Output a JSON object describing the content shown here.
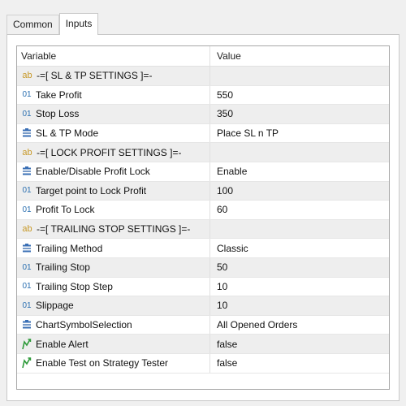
{
  "tabs": [
    {
      "label": "Common",
      "active": false
    },
    {
      "label": "Inputs",
      "active": true
    }
  ],
  "table": {
    "columns": [
      "Variable",
      "Value"
    ],
    "rows": [
      {
        "icon": "ab",
        "variable": "-=[ SL & TP SETTINGS ]=-",
        "value": ""
      },
      {
        "icon": "01",
        "variable": "Take Profit",
        "value": "550"
      },
      {
        "icon": "01",
        "variable": "Stop Loss",
        "value": "350"
      },
      {
        "icon": "list",
        "variable": "SL & TP Mode",
        "value": "Place SL n TP"
      },
      {
        "icon": "ab",
        "variable": "-=[ LOCK PROFIT SETTINGS ]=-",
        "value": ""
      },
      {
        "icon": "list",
        "variable": "Enable/Disable Profit Lock",
        "value": "Enable"
      },
      {
        "icon": "01",
        "variable": "Target point to Lock Profit",
        "value": "100"
      },
      {
        "icon": "01",
        "variable": "Profit To Lock",
        "value": "60"
      },
      {
        "icon": "ab",
        "variable": "-=[ TRAILING STOP SETTINGS ]=-",
        "value": ""
      },
      {
        "icon": "list",
        "variable": "Trailing Method",
        "value": "Classic"
      },
      {
        "icon": "01",
        "variable": "Trailing Stop",
        "value": "50"
      },
      {
        "icon": "01",
        "variable": "Trailing Stop Step",
        "value": "10"
      },
      {
        "icon": "01",
        "variable": "Slippage",
        "value": "10"
      },
      {
        "icon": "list",
        "variable": "ChartSymbolSelection",
        "value": "All Opened Orders"
      },
      {
        "icon": "bool",
        "variable": "Enable Alert",
        "value": "false"
      },
      {
        "icon": "bool",
        "variable": "Enable Test on Strategy Tester",
        "value": "false"
      }
    ]
  },
  "icon_glyphs": {
    "ab": "ab",
    "01": "01"
  },
  "colors": {
    "string_icon": "#c89a2a",
    "number_icon": "#2a6fb0",
    "enum_icon": "#3a6fb5",
    "bool_icon": "#2e9a3a",
    "row_alt": "#eeeeee"
  }
}
